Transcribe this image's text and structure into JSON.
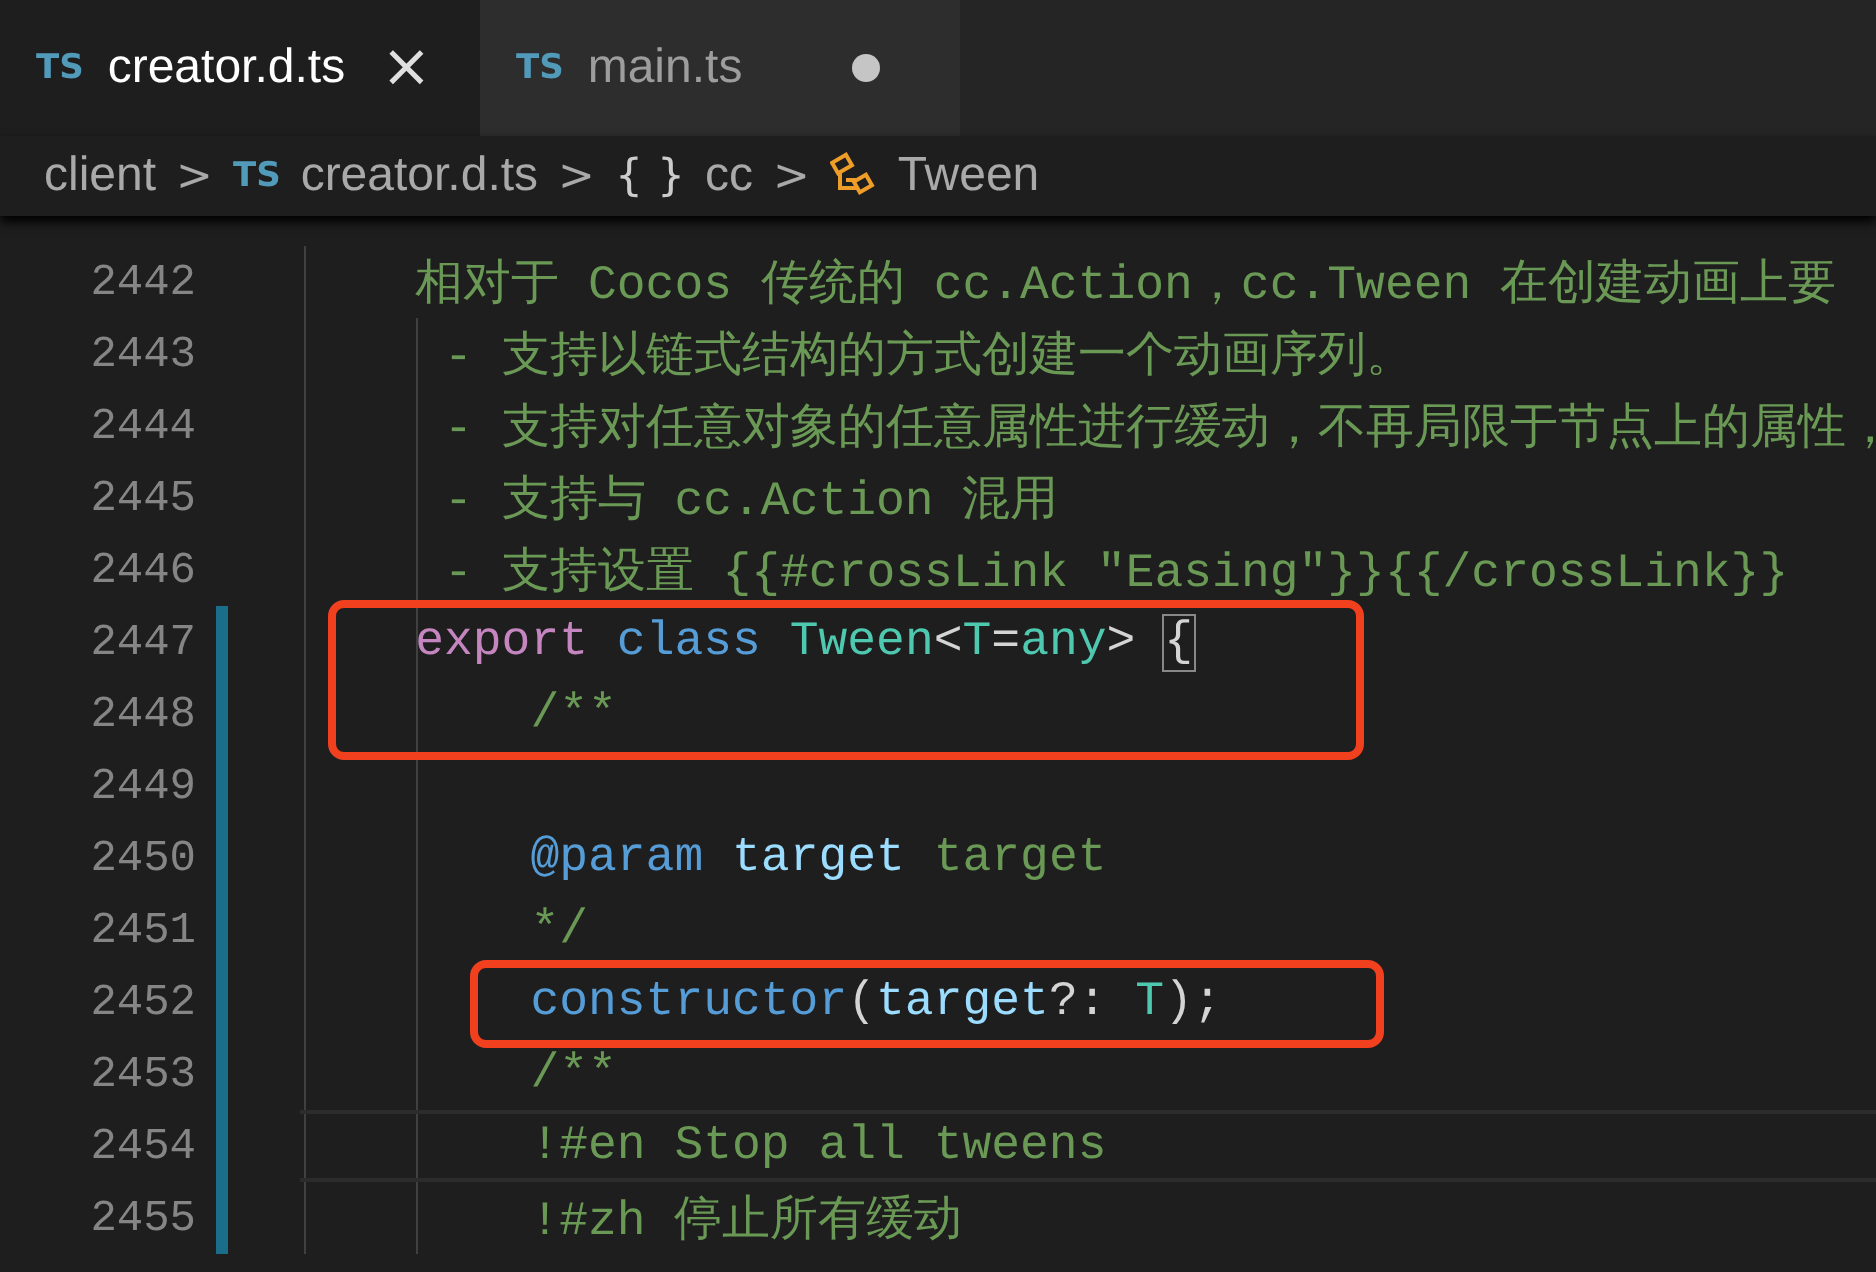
{
  "tabs": [
    {
      "badge": "TS",
      "label": "creator.d.ts",
      "selected": true,
      "dirty": false,
      "close": "×"
    },
    {
      "badge": "TS",
      "label": "main.ts",
      "selected": false,
      "dirty": true
    }
  ],
  "breadcrumb": [
    {
      "kind": "text",
      "label": "client"
    },
    {
      "kind": "file",
      "badge": "TS",
      "label": "creator.d.ts"
    },
    {
      "kind": "namespace",
      "badge": "{ }",
      "label": "cc"
    },
    {
      "kind": "class",
      "label": "Tween"
    }
  ],
  "separator": ">",
  "lines": [
    {
      "number": "2442",
      "kind": "plain",
      "modified": false,
      "current": false,
      "boxed": false,
      "tokens": [
        {
          "kind": "comment",
          "text": "相对于 Cocos 传统的 cc.Action，cc.Tween 在创建动画上要"
        }
      ]
    },
    {
      "number": "2443",
      "kind": "bullet",
      "modified": false,
      "current": false,
      "boxed": false,
      "tokens": [
        {
          "kind": "comment",
          "text": "- 支持以链式结构的方式创建一个动画序列。"
        }
      ]
    },
    {
      "number": "2444",
      "kind": "bullet",
      "modified": false,
      "current": false,
      "boxed": false,
      "tokens": [
        {
          "kind": "comment",
          "text": "- 支持对任意对象的任意属性进行缓动，不再局限于节点上的属性，"
        }
      ]
    },
    {
      "number": "2445",
      "kind": "bullet",
      "modified": false,
      "current": false,
      "boxed": false,
      "tokens": [
        {
          "kind": "comment",
          "text": "- 支持与 cc.Action 混用"
        }
      ]
    },
    {
      "number": "2446",
      "kind": "bullet",
      "modified": false,
      "current": false,
      "boxed": false,
      "tokens": [
        {
          "kind": "comment",
          "text": "- 支持设置 {{#crossLink \"Easing\"}}{{/crossLink}}"
        }
      ]
    },
    {
      "number": "2447",
      "kind": "plain",
      "modified": true,
      "current": false,
      "boxed": true,
      "tokens": [
        {
          "kind": "keyword",
          "text": "export "
        },
        {
          "kind": "storage",
          "text": "class "
        },
        {
          "kind": "type",
          "text": "Tween"
        },
        {
          "kind": "plain",
          "text": "<"
        },
        {
          "kind": "type",
          "text": "T"
        },
        {
          "kind": "plain",
          "text": "="
        },
        {
          "kind": "type",
          "text": "any"
        },
        {
          "kind": "plain",
          "text": "> "
        },
        {
          "kind": "bracket",
          "text": "{"
        }
      ],
      "children": [
        {
          "number": "2448",
          "kind": "plain",
          "modified": true,
          "current": false,
          "boxed": true,
          "tokens": [
            {
              "kind": "comment",
              "text": "/**"
            }
          ]
        },
        {
          "number": "2449",
          "kind": "plain",
          "modified": true,
          "current": false,
          "boxed": false
        },
        {
          "number": "2450",
          "kind": "plain",
          "modified": true,
          "current": false,
          "boxed": false,
          "tokens": [
            {
              "kind": "storage",
              "text": "@param "
            },
            {
              "kind": "variable",
              "text": "target "
            },
            {
              "kind": "comment",
              "text": "target"
            }
          ]
        },
        {
          "number": "2451",
          "kind": "plain",
          "modified": true,
          "current": false,
          "boxed": false,
          "tokens": [
            {
              "kind": "comment",
              "text": "*/"
            }
          ]
        },
        {
          "number": "2452",
          "kind": "plain",
          "modified": true,
          "current": false,
          "boxed": true,
          "tokens": [
            {
              "kind": "storage",
              "text": "constructor"
            },
            {
              "kind": "plain",
              "text": "("
            },
            {
              "kind": "variable",
              "text": "target"
            },
            {
              "kind": "plain",
              "text": "?: "
            },
            {
              "kind": "type",
              "text": "T"
            },
            {
              "kind": "plain",
              "text": ");"
            }
          ]
        },
        {
          "number": "2453",
          "kind": "plain",
          "modified": true,
          "current": false,
          "boxed": false,
          "tokens": [
            {
              "kind": "comment",
              "text": "/**"
            }
          ]
        },
        {
          "number": "2454",
          "kind": "plain",
          "modified": true,
          "current": true,
          "boxed": false,
          "tokens": [
            {
              "kind": "comment",
              "text": "!#en Stop all tweens"
            }
          ]
        },
        {
          "number": "2455",
          "kind": "plain",
          "modified": true,
          "current": false,
          "boxed": false,
          "tokens": [
            {
              "kind": "comment",
              "text": "!#zh 停止所有缓动"
            }
          ]
        }
      ]
    }
  ]
}
